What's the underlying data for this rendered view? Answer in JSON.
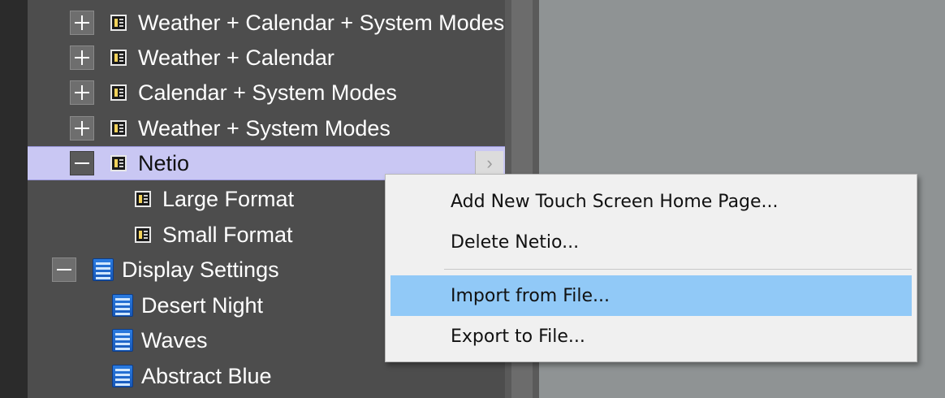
{
  "tree": {
    "items": [
      {
        "label": "Weather + Calendar + System Modes",
        "expander": "+",
        "icon": "page-icon"
      },
      {
        "label": "Weather + Calendar",
        "expander": "+",
        "icon": "page-icon"
      },
      {
        "label": "Calendar + System Modes",
        "expander": "+",
        "icon": "page-icon"
      },
      {
        "label": "Weather + System Modes",
        "expander": "+",
        "icon": "page-icon"
      },
      {
        "label": "Netio",
        "expander": "−",
        "icon": "page-icon",
        "selected": true
      },
      {
        "label": "Large Format",
        "icon": "page-icon"
      },
      {
        "label": "Small Format",
        "icon": "page-icon"
      },
      {
        "label": "Display Settings",
        "expander": "−",
        "icon": "display-settings-icon"
      },
      {
        "label": "Desert Night",
        "icon": "display-settings-icon"
      },
      {
        "label": "Waves",
        "icon": "display-settings-icon"
      },
      {
        "label": "Abstract Blue",
        "icon": "display-settings-icon"
      }
    ],
    "selected_row_arrow": "›"
  },
  "context_menu": {
    "items": [
      {
        "label": "Add New Touch Screen Home Page..."
      },
      {
        "label": "Delete Netio..."
      },
      {
        "label": "Import from File...",
        "highlighted": true
      },
      {
        "label": "Export to File..."
      }
    ]
  },
  "colors": {
    "tree_background": "#4d4d4d",
    "selection": "#c9c7f3",
    "menu_highlight": "#91c9f7",
    "menu_background": "#f0f0f0"
  }
}
